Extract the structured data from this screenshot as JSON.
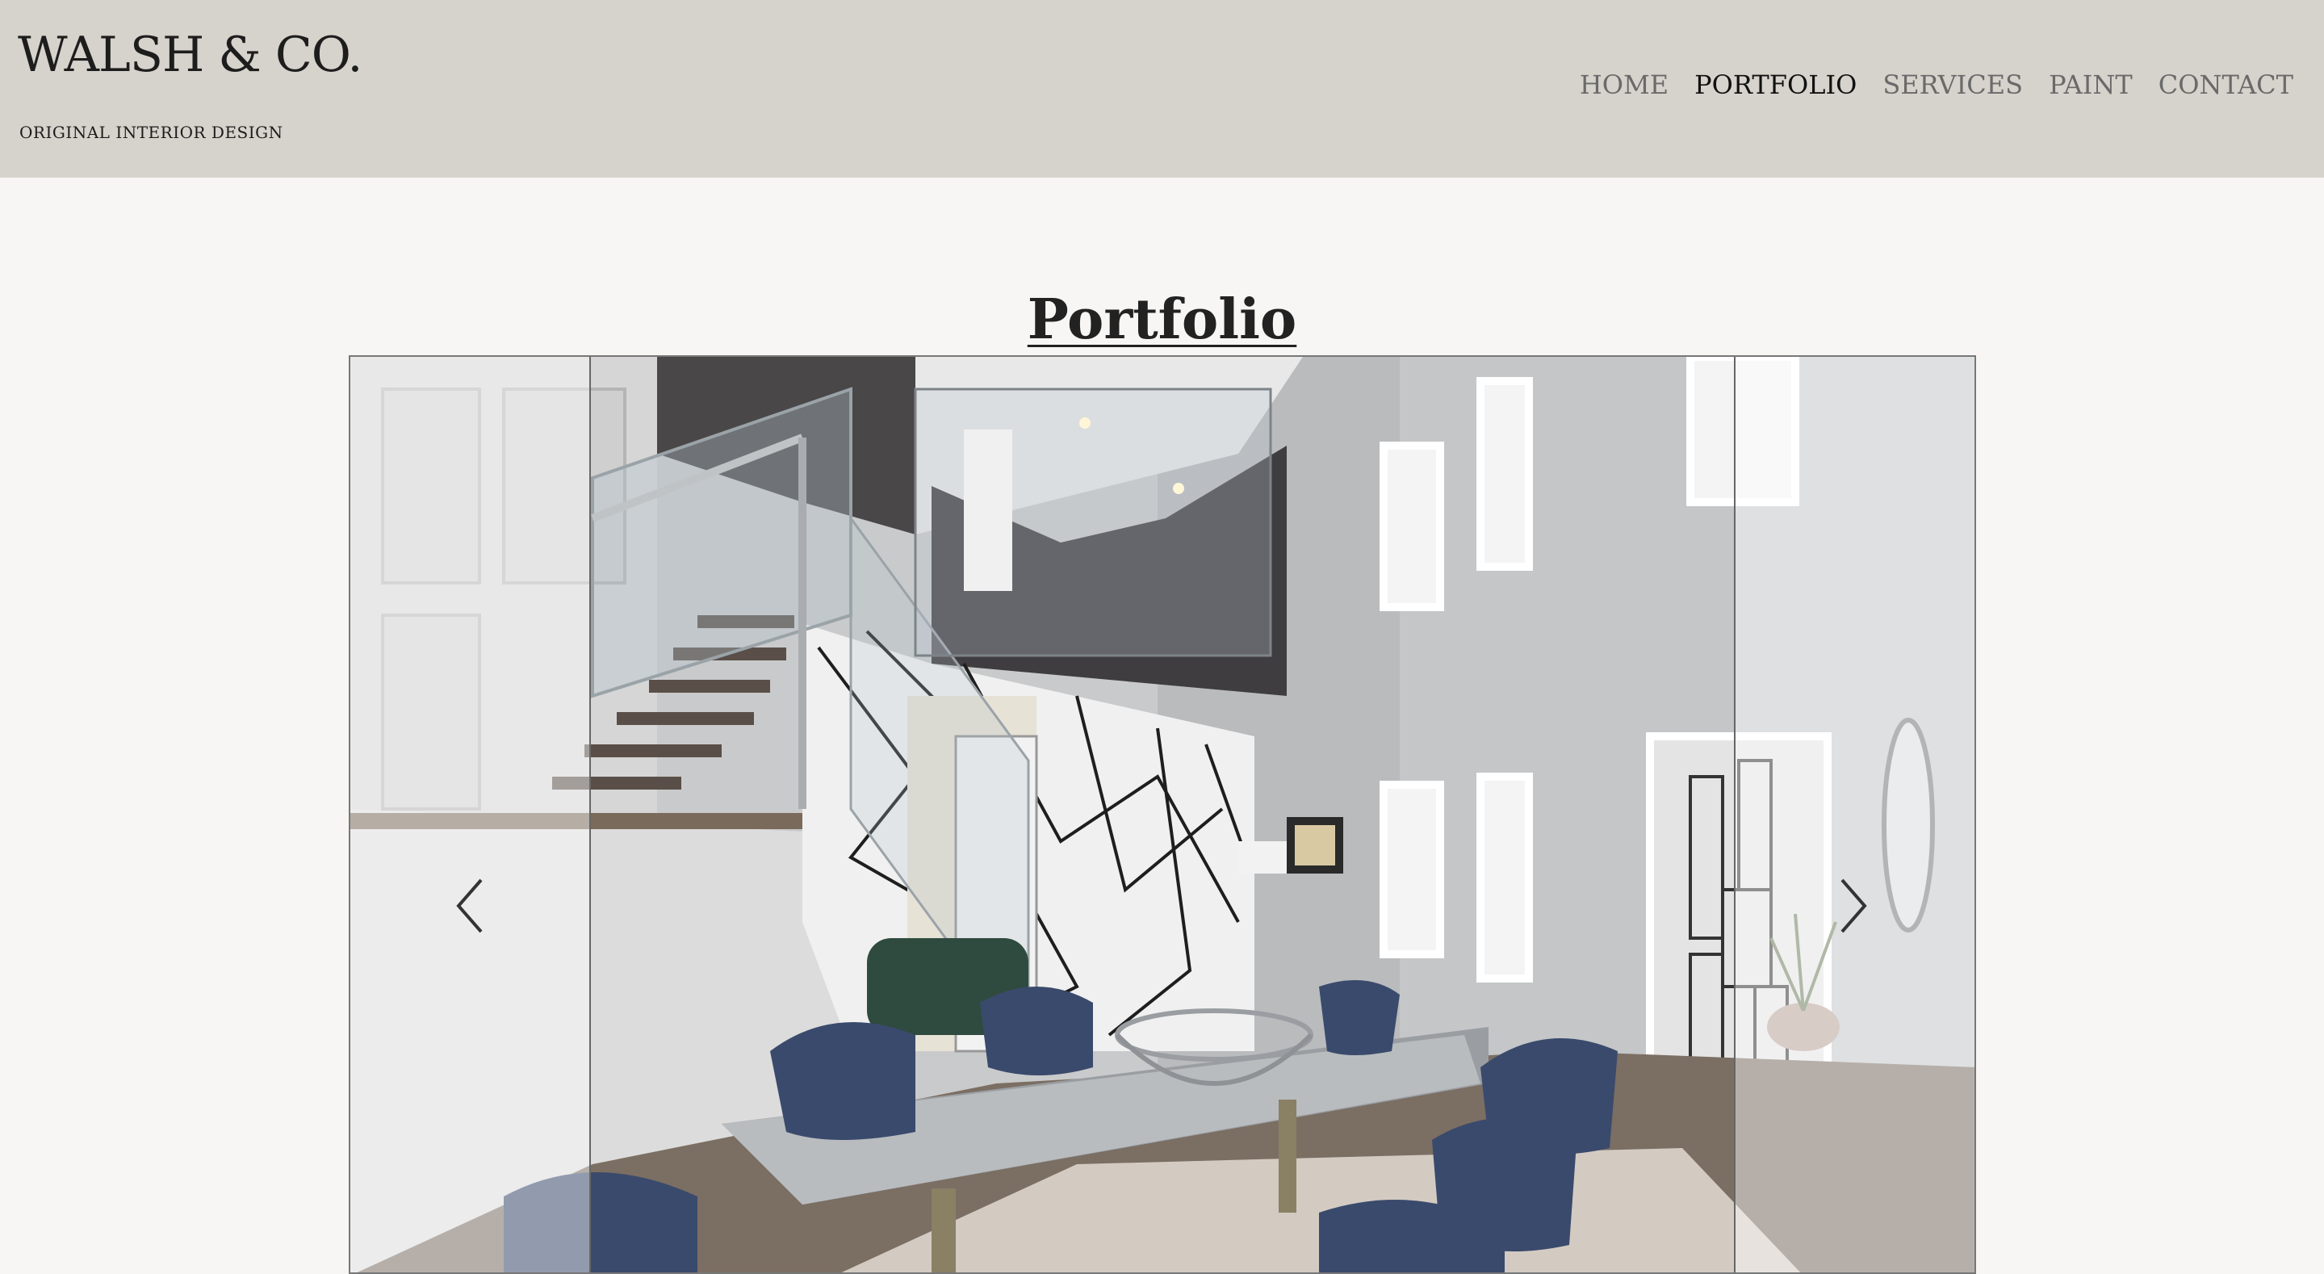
{
  "header": {
    "brand": "WALSH & CO.",
    "tagline": "ORIGINAL INTERIOR DESIGN",
    "nav": [
      {
        "label": "HOME",
        "active": false
      },
      {
        "label": "PORTFOLIO",
        "active": true
      },
      {
        "label": "SERVICES",
        "active": false
      },
      {
        "label": "PAINT",
        "active": false
      },
      {
        "label": "CONTACT",
        "active": false
      }
    ]
  },
  "main": {
    "title": "Portfolio"
  },
  "carousel": {
    "prev_icon": "chevron-left-icon",
    "next_icon": "chevron-right-icon"
  },
  "colors": {
    "header_bg": "#d6d3cc",
    "page_bg": "#f7f6f4",
    "text_dark": "#1d1d1d",
    "nav_inactive": "#6a6a6a"
  }
}
